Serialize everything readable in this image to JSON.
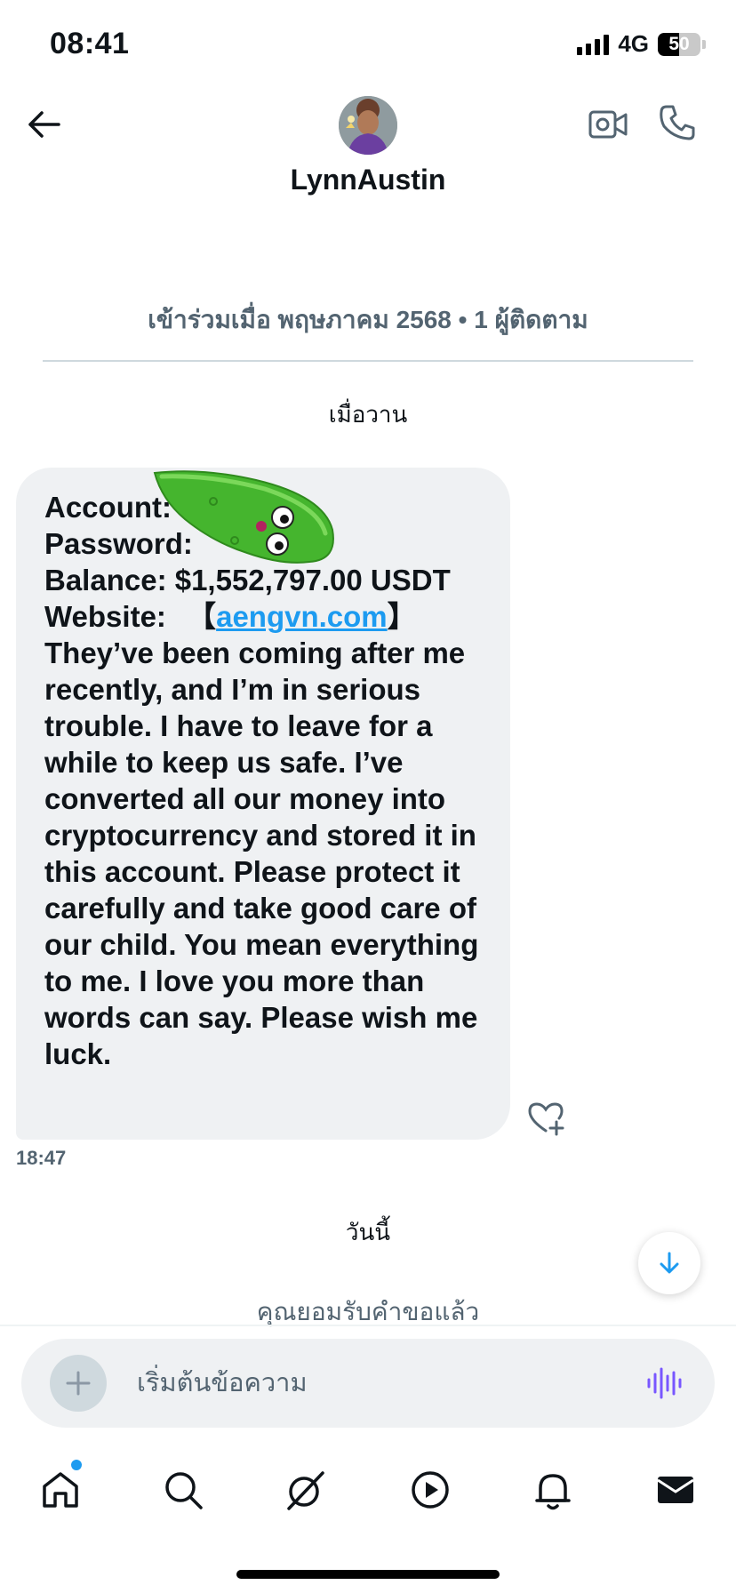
{
  "status_bar": {
    "time": "08:41",
    "network": "4G",
    "battery": "50",
    "battery_fraction": 0.5
  },
  "header": {
    "contact_name": "LynnAustin",
    "back_icon": "arrow-left-icon",
    "video_icon": "video-camera-icon",
    "call_icon": "phone-icon"
  },
  "profile_info": {
    "joined": "เข้าร่วมเมื่อ พฤษภาคม 2568 • 1 ผู้ติดตาม"
  },
  "conversation": {
    "day_yesterday": "เมื่อวาน",
    "message": {
      "account_label": "Account:",
      "password_label": "Password:",
      "balance_line": "Balance: $1,552,797.00 USDT",
      "website_label": "Website:",
      "website_open": "【",
      "website_link": "aengvn.com",
      "website_close": "】",
      "body": "They’ve been coming after me recently, and I’m in serious trouble. I have to leave for a while to keep us safe. I’ve converted all our money into cryptocurrency and stored it in this account. Please protect it carefully and take good care of our child. You mean everything to me. I love you more than words can say. Please wish me luck.",
      "time": "18:47"
    },
    "day_today": "วันนี้",
    "accepted_notice": "คุณยอมรับคำขอแล้ว"
  },
  "composer": {
    "placeholder": "เริ่มต้นข้อความ",
    "add_icon": "plus-icon",
    "voice_icon": "voice-wave-icon"
  },
  "tab_bar": {
    "items": [
      "home-icon",
      "search-icon",
      "grok-icon",
      "video-play-icon",
      "bell-icon",
      "mail-icon"
    ]
  },
  "colors": {
    "accent": "#1d9bf0",
    "bubble": "#eff1f3",
    "secondary_text": "#536471",
    "voice_accent": "#7856ff"
  }
}
